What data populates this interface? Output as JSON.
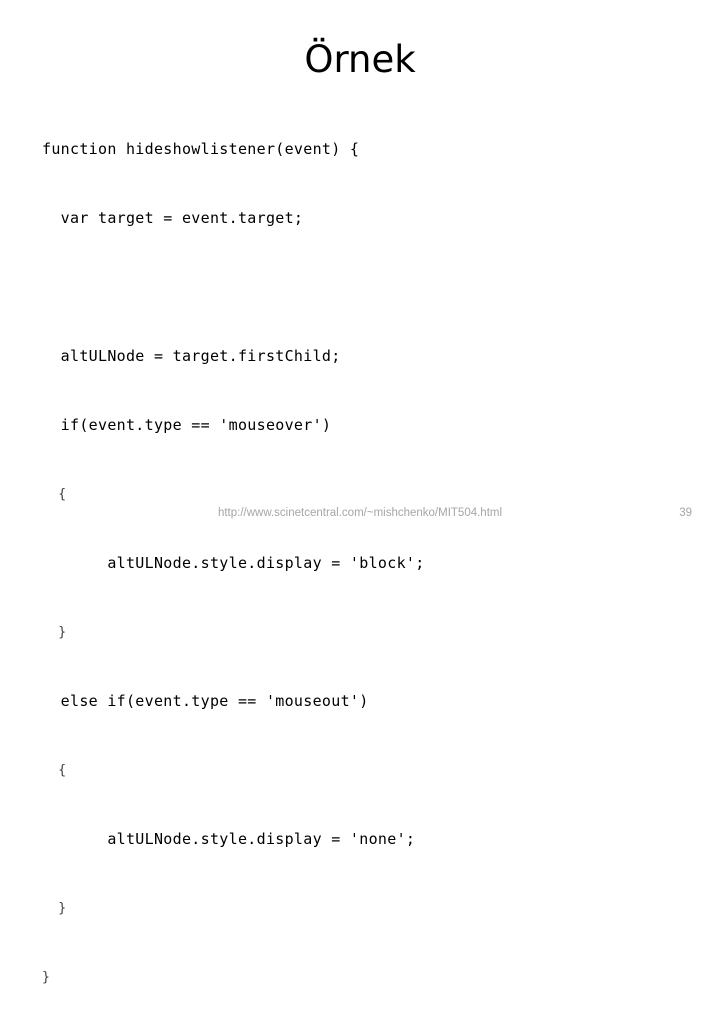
{
  "slide": {
    "title": "Örnek",
    "code_lines": [
      "function hideshowlistener(event) {",
      "  var target = event.target;",
      "",
      "  altULNode = target.firstChild;",
      "  if(event.type == 'mouseover')",
      "  {",
      "       altULNode.style.display = 'block';",
      "  }",
      "  else if(event.type == 'mouseout')",
      "  {",
      "       altULNode.style.display = 'none';",
      "  }",
      "}"
    ],
    "footer": {
      "url": "http://www.scinetcentral.com/~mishchenko/MIT504.html",
      "page_number": "39"
    },
    "colors": {
      "background": "#ffffff",
      "text": "#000000",
      "footer_text": "#a6a6a6"
    }
  }
}
